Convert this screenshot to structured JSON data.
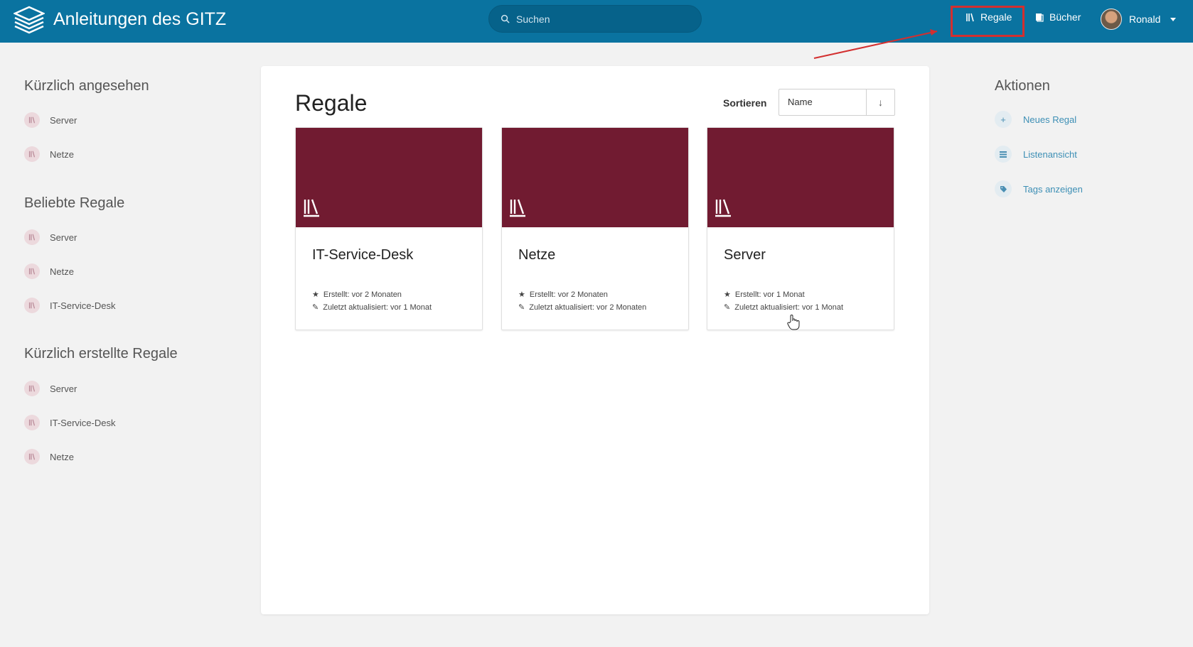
{
  "header": {
    "title": "Anleitungen des GITZ",
    "search_placeholder": "Suchen",
    "nav": {
      "regale": "Regale",
      "buecher": "Bücher"
    },
    "user": "Ronald"
  },
  "sidebar": {
    "recently_viewed": {
      "title": "Kürzlich angesehen",
      "items": [
        "Server",
        "Netze"
      ]
    },
    "popular": {
      "title": "Beliebte Regale",
      "items": [
        "Server",
        "Netze",
        "IT-Service-Desk"
      ]
    },
    "recently_created": {
      "title": "Kürzlich erstellte Regale",
      "items": [
        "Server",
        "IT-Service-Desk",
        "Netze"
      ]
    }
  },
  "main": {
    "title": "Regale",
    "sort_label": "Sortieren",
    "sort_value": "Name",
    "sort_direction": "↓",
    "cards": [
      {
        "title": "IT-Service-Desk",
        "created": "Erstellt: vor 2 Monaten",
        "updated": "Zuletzt aktualisiert: vor 1 Monat"
      },
      {
        "title": "Netze",
        "created": "Erstellt: vor 2 Monaten",
        "updated": "Zuletzt aktualisiert: vor 2 Monaten"
      },
      {
        "title": "Server",
        "created": "Erstellt: vor 1 Monat",
        "updated": "Zuletzt aktualisiert: vor 1 Monat"
      }
    ]
  },
  "actions": {
    "title": "Aktionen",
    "items": [
      "Neues Regal",
      "Listenansicht",
      "Tags anzeigen"
    ]
  },
  "colors": {
    "header": "#0a73a0",
    "shelf_cover": "#711b31",
    "highlight": "#d32f2f",
    "action_link": "#3d8fb5"
  },
  "icons": {
    "logo": "stacked-books-icon",
    "shelf": "shelf-icon",
    "book": "book-icon",
    "new": "plus-icon",
    "list": "list-icon",
    "tag": "tag-icon",
    "star": "star-icon",
    "edit": "pencil-icon"
  }
}
